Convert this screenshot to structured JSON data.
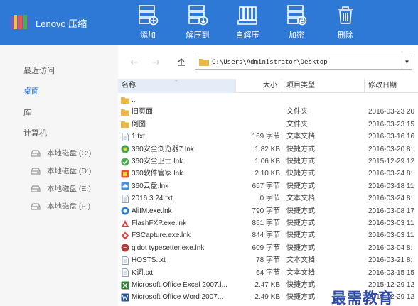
{
  "app": {
    "title": "Lenovo 压缩"
  },
  "toolbar": [
    {
      "label": "添加",
      "icon": "add-icon"
    },
    {
      "label": "解压到",
      "icon": "extract-to-icon"
    },
    {
      "label": "自解压",
      "icon": "self-extract-icon"
    },
    {
      "label": "加密",
      "icon": "encrypt-icon"
    },
    {
      "label": "删除",
      "icon": "delete-icon"
    }
  ],
  "sidebar": {
    "items": [
      {
        "label": "最近访问",
        "active": false
      },
      {
        "label": "桌面",
        "active": true
      },
      {
        "label": "库",
        "active": false
      },
      {
        "label": "计算机",
        "active": false
      }
    ],
    "drives": [
      {
        "label": "本地磁盘 (C:)"
      },
      {
        "label": "本地磁盘 (D:)"
      },
      {
        "label": "本地磁盘 (E:)"
      },
      {
        "label": "本地磁盘 (F:)"
      }
    ]
  },
  "address": {
    "path": "C:\\Users\\Administrator\\Desktop"
  },
  "columns": {
    "name": "名称",
    "size": "大小",
    "type": "项目类型",
    "date": "修改日期"
  },
  "files": [
    {
      "name": "..",
      "size": "",
      "type": "",
      "date": "",
      "icon": "folder-icon"
    },
    {
      "name": "旧页面",
      "size": "",
      "type": "文件夹",
      "date": "2016-03-23 20",
      "icon": "folder-icon"
    },
    {
      "name": "例图",
      "size": "",
      "type": "文件夹",
      "date": "2016-03-23 15",
      "icon": "folder-icon"
    },
    {
      "name": "1.txt",
      "size": "169 字节",
      "type": "文本文档",
      "date": "2016-03-16 16",
      "icon": "text-file-icon"
    },
    {
      "name": "360安全浏览器7.lnk",
      "size": "1.82 KB",
      "type": "快捷方式",
      "date": "2016-03-20 8:",
      "icon": "browser-360-icon"
    },
    {
      "name": "360安全卫士.lnk",
      "size": "1.06 KB",
      "type": "快捷方式",
      "date": "2015-12-29 12",
      "icon": "security-360-icon"
    },
    {
      "name": "360软件管家.lnk",
      "size": "2.10 KB",
      "type": "快捷方式",
      "date": "2016-03-24 8:",
      "icon": "software-manager-360-icon"
    },
    {
      "name": "360云盘.lnk",
      "size": "657 字节",
      "type": "快捷方式",
      "date": "2016-03-18 11",
      "icon": "cloud-drive-360-icon"
    },
    {
      "name": "2016.3.24.txt",
      "size": "0 字节",
      "type": "文本文档",
      "date": "2016-03-24 8:",
      "icon": "text-file-icon"
    },
    {
      "name": "AliIM.exe.lnk",
      "size": "790 字节",
      "type": "快捷方式",
      "date": "2016-03-08 17",
      "icon": "aliim-icon"
    },
    {
      "name": "FlashFXP.exe.lnk",
      "size": "851 字节",
      "type": "快捷方式",
      "date": "2016-03-03 11",
      "icon": "flashfxp-icon"
    },
    {
      "name": "FSCapture.exe.lnk",
      "size": "844 字节",
      "type": "快捷方式",
      "date": "2016-03-03 11",
      "icon": "fscapture-icon"
    },
    {
      "name": "gidot typesetter.exe.lnk",
      "size": "609 字节",
      "type": "快捷方式",
      "date": "2016-03-04 8:",
      "icon": "gidot-icon"
    },
    {
      "name": "HOSTS.txt",
      "size": "78 字节",
      "type": "文本文档",
      "date": "2016-03-21 8:",
      "icon": "text-file-icon"
    },
    {
      "name": "K词.txt",
      "size": "64 字节",
      "type": "文本文档",
      "date": "2016-03-15 15",
      "icon": "text-file-icon"
    },
    {
      "name": "Microsoft Office Excel 2007.l...",
      "size": "2.47 KB",
      "type": "快捷方式",
      "date": "2015-12-29 12",
      "icon": "excel-icon"
    },
    {
      "name": "Microsoft Office Word 2007...",
      "size": "2.49 KB",
      "type": "快捷方式",
      "date": "2015-12-29 12",
      "icon": "word-icon"
    }
  ],
  "watermark": "最需教育",
  "colors": {
    "accent": "#2e78d6",
    "sidebar_bg": "#f6f6f6",
    "folder": "#e8b94a"
  }
}
